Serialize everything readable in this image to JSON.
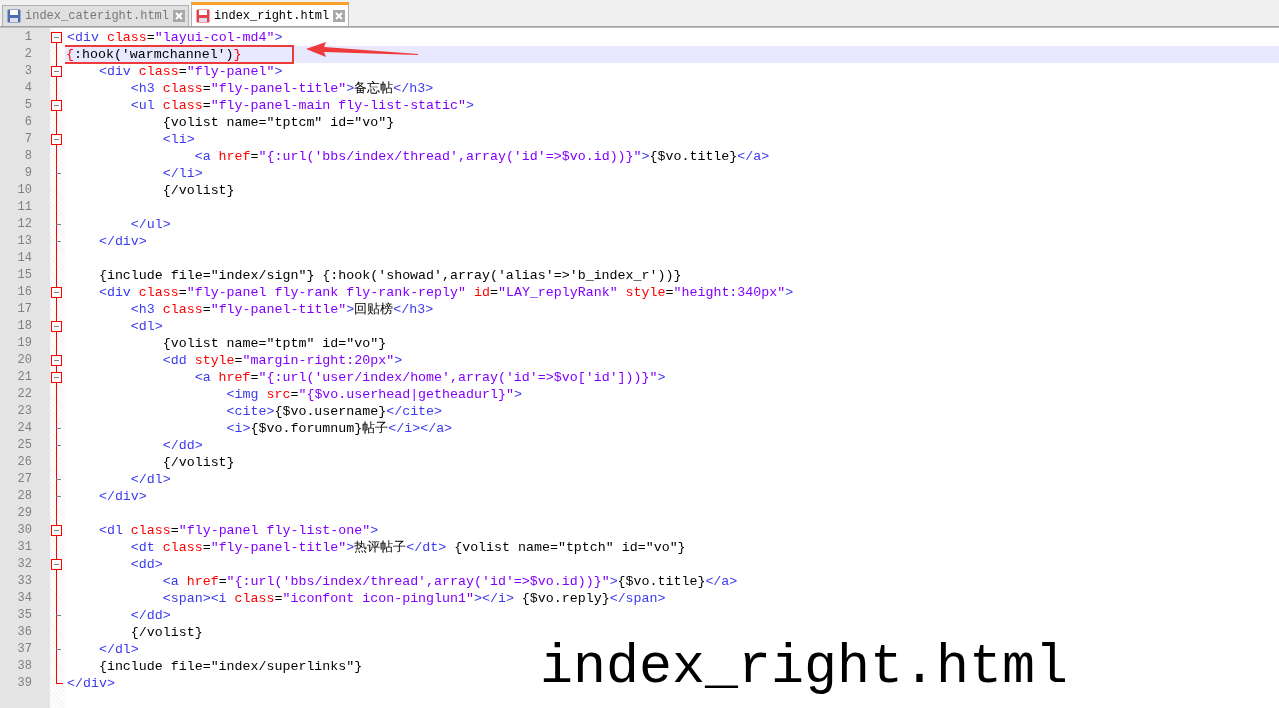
{
  "tabs": [
    {
      "label": "index_cateright.html",
      "selected": false,
      "modified": false
    },
    {
      "label": "index_right.html",
      "selected": true,
      "modified": true
    }
  ],
  "editor": {
    "lines": [
      {
        "number": "1",
        "kind": "open",
        "current": false,
        "boxed": false,
        "tokens": [
          {
            "kind": "tag",
            "t": "<div"
          },
          {
            "kind": "attr",
            "t": " class"
          },
          {
            "kind": "txt",
            "t": "="
          },
          {
            "kind": "val",
            "t": "\"layui-col-md4\""
          },
          {
            "kind": "tag",
            "t": ">"
          }
        ]
      },
      {
        "number": "2",
        "kind": "plain",
        "current": true,
        "boxed": true,
        "tokens": [
          {
            "kind": "red",
            "t": "{"
          },
          {
            "kind": "txt",
            "t": ":hook('warmchannel')"
          },
          {
            "kind": "red",
            "t": "}"
          }
        ]
      },
      {
        "number": "3",
        "kind": "open",
        "current": false,
        "boxed": false,
        "tokens": [
          {
            "kind": "tag",
            "t": "    <div"
          },
          {
            "kind": "attr",
            "t": " class"
          },
          {
            "kind": "txt",
            "t": "="
          },
          {
            "kind": "val",
            "t": "\"fly-panel\""
          },
          {
            "kind": "tag",
            "t": ">"
          }
        ]
      },
      {
        "number": "4",
        "kind": "plain",
        "current": false,
        "boxed": false,
        "tokens": [
          {
            "kind": "tag",
            "t": "        <h3"
          },
          {
            "kind": "attr",
            "t": " class"
          },
          {
            "kind": "txt",
            "t": "="
          },
          {
            "kind": "val",
            "t": "\"fly-panel-title\""
          },
          {
            "kind": "tag",
            "t": ">"
          },
          {
            "kind": "txt",
            "t": "备忘帖"
          },
          {
            "kind": "tag",
            "t": "</h3>"
          }
        ]
      },
      {
        "number": "5",
        "kind": "open",
        "current": false,
        "boxed": false,
        "tokens": [
          {
            "kind": "tag",
            "t": "        <ul"
          },
          {
            "kind": "attr",
            "t": " class"
          },
          {
            "kind": "txt",
            "t": "="
          },
          {
            "kind": "val",
            "t": "\"fly-panel-main fly-list-static\""
          },
          {
            "kind": "tag",
            "t": ">"
          }
        ]
      },
      {
        "number": "6",
        "kind": "plain",
        "current": false,
        "boxed": false,
        "tokens": [
          {
            "kind": "txt",
            "t": "            {volist name=\"tptcm\" id=\"vo\"}"
          }
        ]
      },
      {
        "number": "7",
        "kind": "open",
        "current": false,
        "boxed": false,
        "tokens": [
          {
            "kind": "tag",
            "t": "            <li>"
          }
        ]
      },
      {
        "number": "8",
        "kind": "plain",
        "current": false,
        "boxed": false,
        "tokens": [
          {
            "kind": "tag",
            "t": "                <a"
          },
          {
            "kind": "attr",
            "t": " href"
          },
          {
            "kind": "txt",
            "t": "="
          },
          {
            "kind": "val",
            "t": "\"{:url('bbs/index/thread',array('id'=>$vo.id))}\""
          },
          {
            "kind": "tag",
            "t": ">"
          },
          {
            "kind": "txt",
            "t": "{$vo.title}"
          },
          {
            "kind": "tag",
            "t": "</a>"
          }
        ]
      },
      {
        "number": "9",
        "kind": "close",
        "current": false,
        "boxed": false,
        "tokens": [
          {
            "kind": "tag",
            "t": "            </li>"
          }
        ]
      },
      {
        "number": "10",
        "kind": "plain",
        "current": false,
        "boxed": false,
        "tokens": [
          {
            "kind": "txt",
            "t": "            {/volist}"
          }
        ]
      },
      {
        "number": "11",
        "kind": "plain",
        "current": false,
        "boxed": false
      },
      {
        "number": "12",
        "kind": "close",
        "current": false,
        "boxed": false,
        "tokens": [
          {
            "kind": "tag",
            "t": "        </ul>"
          }
        ]
      },
      {
        "number": "13",
        "kind": "close",
        "current": false,
        "boxed": false,
        "tokens": [
          {
            "kind": "tag",
            "t": "    </div>"
          }
        ]
      },
      {
        "number": "14",
        "kind": "plain",
        "current": false,
        "boxed": false
      },
      {
        "number": "15",
        "kind": "plain",
        "current": false,
        "boxed": false,
        "tokens": [
          {
            "kind": "txt",
            "t": "    {include file=\"index/sign\"} {:hook('showad',array('alias'=>'b_index_r'))}"
          }
        ]
      },
      {
        "number": "16",
        "kind": "open",
        "current": false,
        "boxed": false,
        "tokens": [
          {
            "kind": "tag",
            "t": "    <div"
          },
          {
            "kind": "attr",
            "t": " class"
          },
          {
            "kind": "txt",
            "t": "="
          },
          {
            "kind": "val",
            "t": "\"fly-panel fly-rank fly-rank-reply\""
          },
          {
            "kind": "attr",
            "t": " id"
          },
          {
            "kind": "txt",
            "t": "="
          },
          {
            "kind": "val",
            "t": "\"LAY_replyRank\""
          },
          {
            "kind": "attr",
            "t": " style"
          },
          {
            "kind": "txt",
            "t": "="
          },
          {
            "kind": "val",
            "t": "\"height:340px\""
          },
          {
            "kind": "tag",
            "t": ">"
          }
        ]
      },
      {
        "number": "17",
        "kind": "plain",
        "current": false,
        "boxed": false,
        "tokens": [
          {
            "kind": "tag",
            "t": "        <h3"
          },
          {
            "kind": "attr",
            "t": " class"
          },
          {
            "kind": "txt",
            "t": "="
          },
          {
            "kind": "val",
            "t": "\"fly-panel-title\""
          },
          {
            "kind": "tag",
            "t": ">"
          },
          {
            "kind": "txt",
            "t": "回贴榜"
          },
          {
            "kind": "tag",
            "t": "</h3>"
          }
        ]
      },
      {
        "number": "18",
        "kind": "open",
        "current": false,
        "boxed": false,
        "tokens": [
          {
            "kind": "tag",
            "t": "        <dl>"
          }
        ]
      },
      {
        "number": "19",
        "kind": "plain",
        "current": false,
        "boxed": false,
        "tokens": [
          {
            "kind": "txt",
            "t": "            {volist name=\"tptm\" id=\"vo\"}"
          }
        ]
      },
      {
        "number": "20",
        "kind": "open",
        "current": false,
        "boxed": false,
        "tokens": [
          {
            "kind": "tag",
            "t": "            <dd"
          },
          {
            "kind": "attr",
            "t": " style"
          },
          {
            "kind": "txt",
            "t": "="
          },
          {
            "kind": "val",
            "t": "\"margin-right:20px\""
          },
          {
            "kind": "tag",
            "t": ">"
          }
        ]
      },
      {
        "number": "21",
        "kind": "open",
        "current": false,
        "boxed": false,
        "tokens": [
          {
            "kind": "tag",
            "t": "                <a"
          },
          {
            "kind": "attr",
            "t": " href"
          },
          {
            "kind": "txt",
            "t": "="
          },
          {
            "kind": "val",
            "t": "\"{:url('user/index/home',array('id'=>$vo['id']))}\""
          },
          {
            "kind": "tag",
            "t": ">"
          }
        ]
      },
      {
        "number": "22",
        "kind": "plain",
        "current": false,
        "boxed": false,
        "tokens": [
          {
            "kind": "tag",
            "t": "                    <img"
          },
          {
            "kind": "attr",
            "t": " src"
          },
          {
            "kind": "txt",
            "t": "="
          },
          {
            "kind": "val",
            "t": "\"{$vo.userhead|getheadurl}\""
          },
          {
            "kind": "tag",
            "t": ">"
          }
        ]
      },
      {
        "number": "23",
        "kind": "plain",
        "current": false,
        "boxed": false,
        "tokens": [
          {
            "kind": "tag",
            "t": "                    <cite>"
          },
          {
            "kind": "txt",
            "t": "{$vo.username}"
          },
          {
            "kind": "tag",
            "t": "</cite>"
          }
        ]
      },
      {
        "number": "24",
        "kind": "close",
        "current": false,
        "boxed": false,
        "tokens": [
          {
            "kind": "tag",
            "t": "                    <i>"
          },
          {
            "kind": "txt",
            "t": "{$vo.forumnum}帖子"
          },
          {
            "kind": "tag",
            "t": "</i></a>"
          }
        ]
      },
      {
        "number": "25",
        "kind": "close",
        "current": false,
        "boxed": false,
        "tokens": [
          {
            "kind": "tag",
            "t": "            </dd>"
          }
        ]
      },
      {
        "number": "26",
        "kind": "plain",
        "current": false,
        "boxed": false,
        "tokens": [
          {
            "kind": "txt",
            "t": "            {/volist}"
          }
        ]
      },
      {
        "number": "27",
        "kind": "close",
        "current": false,
        "boxed": false,
        "tokens": [
          {
            "kind": "tag",
            "t": "        </dl>"
          }
        ]
      },
      {
        "number": "28",
        "kind": "close",
        "current": false,
        "boxed": false,
        "tokens": [
          {
            "kind": "tag",
            "t": "    </div>"
          }
        ]
      },
      {
        "number": "29",
        "kind": "plain",
        "current": false,
        "boxed": false
      },
      {
        "number": "30",
        "kind": "open",
        "current": false,
        "boxed": false,
        "tokens": [
          {
            "kind": "tag",
            "t": "    <dl"
          },
          {
            "kind": "attr",
            "t": " class"
          },
          {
            "kind": "txt",
            "t": "="
          },
          {
            "kind": "val",
            "t": "\"fly-panel fly-list-one\""
          },
          {
            "kind": "tag",
            "t": ">"
          }
        ]
      },
      {
        "number": "31",
        "kind": "plain",
        "current": false,
        "boxed": false,
        "tokens": [
          {
            "kind": "tag",
            "t": "        <dt"
          },
          {
            "kind": "attr",
            "t": " class"
          },
          {
            "kind": "txt",
            "t": "="
          },
          {
            "kind": "val",
            "t": "\"fly-panel-title\""
          },
          {
            "kind": "tag",
            "t": ">"
          },
          {
            "kind": "txt",
            "t": "热评帖子"
          },
          {
            "kind": "tag",
            "t": "</dt>"
          },
          {
            "kind": "txt",
            "t": " {volist name=\"tptch\" id=\"vo\"}"
          }
        ]
      },
      {
        "number": "32",
        "kind": "open",
        "current": false,
        "boxed": false,
        "tokens": [
          {
            "kind": "tag",
            "t": "        <dd>"
          }
        ]
      },
      {
        "number": "33",
        "kind": "plain",
        "current": false,
        "boxed": false,
        "tokens": [
          {
            "kind": "tag",
            "t": "            <a"
          },
          {
            "kind": "attr",
            "t": " href"
          },
          {
            "kind": "txt",
            "t": "="
          },
          {
            "kind": "val",
            "t": "\"{:url('bbs/index/thread',array('id'=>$vo.id))}\""
          },
          {
            "kind": "tag",
            "t": ">"
          },
          {
            "kind": "txt",
            "t": "{$vo.title}"
          },
          {
            "kind": "tag",
            "t": "</a>"
          }
        ]
      },
      {
        "number": "34",
        "kind": "plain",
        "current": false,
        "boxed": false,
        "tokens": [
          {
            "kind": "tag",
            "t": "            <span><i"
          },
          {
            "kind": "attr",
            "t": " class"
          },
          {
            "kind": "txt",
            "t": "="
          },
          {
            "kind": "val",
            "t": "\"iconfont icon-pinglun1\""
          },
          {
            "kind": "tag",
            "t": "></i>"
          },
          {
            "kind": "txt",
            "t": " {$vo.reply}"
          },
          {
            "kind": "tag",
            "t": "</span>"
          }
        ]
      },
      {
        "number": "35",
        "kind": "close",
        "current": false,
        "boxed": false,
        "tokens": [
          {
            "kind": "tag",
            "t": "        </dd>"
          }
        ]
      },
      {
        "number": "36",
        "kind": "plain",
        "current": false,
        "boxed": false,
        "tokens": [
          {
            "kind": "txt",
            "t": "        {/volist}"
          }
        ]
      },
      {
        "number": "37",
        "kind": "close",
        "current": false,
        "boxed": false,
        "tokens": [
          {
            "kind": "tag",
            "t": "    </dl>"
          }
        ]
      },
      {
        "number": "38",
        "kind": "plain",
        "current": false,
        "boxed": false,
        "tokens": [
          {
            "kind": "txt",
            "t": "    {include file=\"index/superlinks\"}"
          }
        ]
      },
      {
        "number": "39",
        "kind": "last",
        "current": false,
        "boxed": false,
        "tokens": [
          {
            "kind": "tag",
            "t": "</div>"
          }
        ]
      }
    ]
  },
  "caption": "index_right.html"
}
